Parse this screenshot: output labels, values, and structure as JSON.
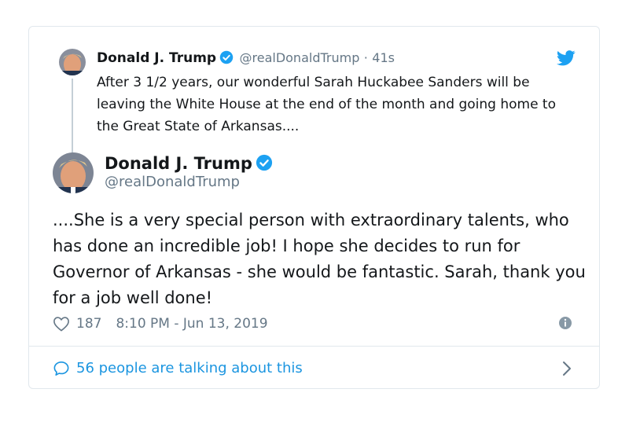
{
  "parent_tweet": {
    "name": "Donald J. Trump",
    "handle": "@realDonaldTrump",
    "separator": "·",
    "time": "41s",
    "text": "After 3 1/2 years, our wonderful Sarah Huckabee Sanders will be leaving the White House at the end of the month and going home to the Great State of Arkansas...."
  },
  "main_tweet": {
    "name": "Donald J. Trump",
    "handle": "@realDonaldTrump",
    "text": "....She is a very special person with extraordinary talents, who has done an incredible job! I hope she decides to run for Governor of Arkansas - she would be fantastic. Sarah, thank you for a job well done!",
    "likes": "187",
    "timestamp": "8:10 PM - Jun 13, 2019"
  },
  "footer": {
    "talking": "56 people are talking about this"
  },
  "colors": {
    "accent": "#1b95e0",
    "verified": "#1da1f2",
    "muted": "#657786",
    "text": "#14171a",
    "border": "#e1e8ed"
  },
  "icons": [
    "avatar",
    "verified-badge-icon",
    "twitter-bird-icon",
    "heart-icon",
    "info-icon",
    "comment-bubble-icon",
    "chevron-right-icon"
  ]
}
